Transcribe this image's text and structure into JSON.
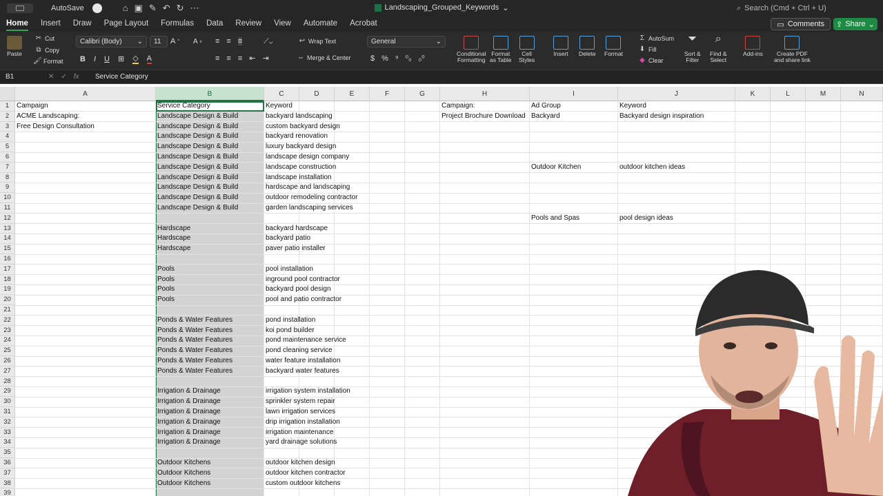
{
  "titlebar": {
    "autosave_label": "AutoSave",
    "doc_title": "Landscaping_Grouped_Keywords",
    "search_placeholder": "Search (Cmd + Ctrl + U)"
  },
  "tabs": [
    "Home",
    "Insert",
    "Draw",
    "Page Layout",
    "Formulas",
    "Data",
    "Review",
    "View",
    "Automate",
    "Acrobat"
  ],
  "buttons": {
    "comments": "Comments",
    "share": "Share"
  },
  "ribbon": {
    "paste": "Paste",
    "cut": "Cut",
    "copy": "Copy",
    "format": "Format",
    "font_name": "Calibri (Body)",
    "font_size": "11",
    "wrap_text": "Wrap Text",
    "merge_center": "Merge & Center",
    "number_format": "General",
    "conditional_formatting": [
      "Conditional",
      "Formatting"
    ],
    "format_as_table": [
      "Format",
      "as Table"
    ],
    "cell_styles": [
      "Cell",
      "Styles"
    ],
    "insert": "Insert",
    "delete": "Delete",
    "format_cells": "Format",
    "autosum": "AutoSum",
    "fill": "Fill",
    "clear": "Clear",
    "sort_filter": [
      "Sort &",
      "Filter"
    ],
    "find_select": [
      "Find &",
      "Select"
    ],
    "addins": "Add-ins",
    "create_pdf": [
      "Create PDF",
      "and share link"
    ]
  },
  "formula_bar": {
    "name_box": "B1",
    "fx": "fx",
    "content": "Service Category"
  },
  "columns": [
    "A",
    "B",
    "C",
    "D",
    "E",
    "F",
    "G",
    "H",
    "I",
    "J",
    "K",
    "L",
    "M",
    "N"
  ],
  "rows": [
    "1",
    "2",
    "3",
    "4",
    "5",
    "6",
    "7",
    "8",
    "9",
    "10",
    "11",
    "12",
    "13",
    "14",
    "15",
    "16",
    "17",
    "18",
    "19",
    "20",
    "21",
    "22",
    "23",
    "24",
    "25",
    "26",
    "27",
    "28",
    "29",
    "30",
    "31",
    "32",
    "33",
    "34",
    "35",
    "36",
    "37",
    "38",
    "39"
  ],
  "cells": {
    "A1": "Campaign",
    "A2": "ACME Landscaping:",
    "A3": "Free Design Consultation",
    "B1": "Service Category",
    "B2": "Landscape Design & Build",
    "B3": "Landscape Design & Build",
    "B4": "Landscape Design & Build",
    "B5": "Landscape Design & Build",
    "B6": "Landscape Design & Build",
    "B7": "Landscape Design & Build",
    "B8": "Landscape Design & Build",
    "B9": "Landscape Design & Build",
    "B10": "Landscape Design & Build",
    "B11": "Landscape Design & Build",
    "B13": "Hardscape",
    "B14": "Hardscape",
    "B15": "Hardscape",
    "B17": "Pools",
    "B18": "Pools",
    "B19": "Pools",
    "B20": "Pools",
    "B22": "Ponds & Water Features",
    "B23": "Ponds & Water Features",
    "B24": "Ponds & Water Features",
    "B25": "Ponds & Water Features",
    "B26": "Ponds & Water Features",
    "B27": "Ponds & Water Features",
    "B29": "Irrigation & Drainage",
    "B30": "Irrigation & Drainage",
    "B31": "Irrigation & Drainage",
    "B32": "Irrigation & Drainage",
    "B33": "Irrigation & Drainage",
    "B34": "Irrigation & Drainage",
    "B36": "Outdoor Kitchens",
    "B37": "Outdoor Kitchens",
    "B38": "Outdoor Kitchens",
    "C1": "Keyword",
    "C2": "backyard landscaping",
    "C3": "custom backyard design",
    "C4": "backyard renovation",
    "C5": "luxury backyard design",
    "C6": "landscape design company",
    "C7": "landscape construction",
    "C8": "landscape installation",
    "C9": "hardscape and landscaping",
    "C10": "outdoor remodeling contractor",
    "C11": "garden landscaping services",
    "C13": "backyard hardscape",
    "C14": "backyard patio",
    "C15": "paver patio installer",
    "C17": "pool installation",
    "C18": "inground pool contractor",
    "C19": "backyard pool design",
    "C20": "pool and patio contractor",
    "C22": "pond installation",
    "C23": "koi pond builder",
    "C24": "pond maintenance service",
    "C25": "pond cleaning service",
    "C26": "water feature installation",
    "C27": "backyard water features",
    "C29": "irrigation system installation",
    "C30": "sprinkler system repair",
    "C31": "lawn irrigation services",
    "C32": "drip irrigation installation",
    "C33": "irrigation maintenance",
    "C34": "yard drainage solutions",
    "C36": "outdoor kitchen design",
    "C37": "outdoor kitchen contractor",
    "C38": "custom outdoor kitchens",
    "H1": "Campaign:",
    "H2": "Project Brochure Download",
    "I1": "Ad Group",
    "I2": "Backyard",
    "I7": "Outdoor Kitchen",
    "I12": "Pools and Spas",
    "J1": "Keyword",
    "J2": "Backyard design inspiration",
    "J7": "outdoor kitchen ideas",
    "J12": "pool design ideas"
  },
  "colors": {
    "accent_green": "#217346",
    "share_green": "#1f8a43",
    "selected_column": "#d3d3d3"
  }
}
